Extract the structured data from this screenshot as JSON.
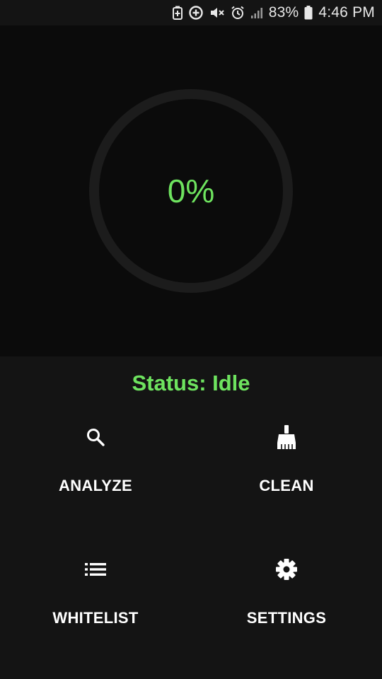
{
  "status_bar": {
    "battery_percent": "83%",
    "time": "4:46 PM",
    "icons": [
      "battery-saver-icon",
      "data-saver-icon",
      "mute-icon",
      "alarm-icon",
      "signal-icon",
      "battery-icon"
    ]
  },
  "progress": {
    "percent_text": "0%",
    "value": 0,
    "ring_color": "#1f1f1f",
    "accent_color": "#6ee35f"
  },
  "status": {
    "text": "Status: Idle"
  },
  "actions": [
    {
      "label": "ANALYZE",
      "icon": "search-icon"
    },
    {
      "label": "CLEAN",
      "icon": "broom-icon"
    },
    {
      "label": "WHITELIST",
      "icon": "list-icon"
    },
    {
      "label": "SETTINGS",
      "icon": "gear-icon"
    }
  ]
}
